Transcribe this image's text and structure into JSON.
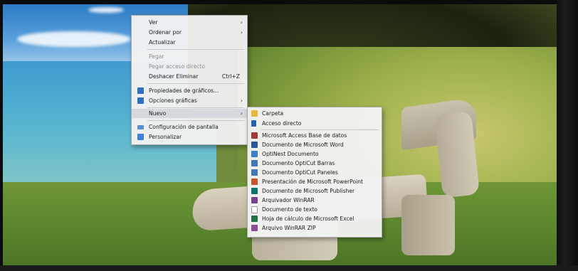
{
  "context_menu": {
    "items": [
      {
        "label": "Ver"
      },
      {
        "label": "Ordenar por"
      },
      {
        "label": "Actualizar"
      },
      {
        "label": "Pegar"
      },
      {
        "label": "Pegar acceso directo"
      },
      {
        "label": "Deshacer Eliminar",
        "shortcut": "Ctrl+Z"
      },
      {
        "label": "Propiedades de gráficos..."
      },
      {
        "label": "Opciones gráficas"
      },
      {
        "label": "Nuevo"
      },
      {
        "label": "Configuración de pantalla"
      },
      {
        "label": "Personalizar"
      }
    ]
  },
  "new_submenu": {
    "items": [
      {
        "label": "Carpeta",
        "icon": "folder-icon",
        "color": "#e8b73a"
      },
      {
        "label": "Acceso directo",
        "icon": "shortcut-icon",
        "color": "#2a62b8"
      },
      {
        "label": "Microsoft Access Base de datos",
        "icon": "access-icon",
        "color": "#a4373a"
      },
      {
        "label": "Documento de Microsoft Word",
        "icon": "word-icon",
        "color": "#2b579a"
      },
      {
        "label": "OptiNest Documento",
        "icon": "optinest-icon",
        "color": "#3a7fc9"
      },
      {
        "label": "Documento OptiCut Barras",
        "icon": "opticut-bars-icon",
        "color": "#3f78b6"
      },
      {
        "label": "Documento OptiCut Paneles",
        "icon": "opticut-panels-icon",
        "color": "#3f78b6"
      },
      {
        "label": "Presentación de Microsoft PowerPoint",
        "icon": "powerpoint-icon",
        "color": "#c8502a"
      },
      {
        "label": "Documento de Microsoft Publisher",
        "icon": "publisher-icon",
        "color": "#077568"
      },
      {
        "label": "Arquivador WinRAR",
        "icon": "winrar-icon",
        "color": "#7b3f8f"
      },
      {
        "label": "Documento de texto",
        "icon": "text-file-icon",
        "color": "#d8d8d8"
      },
      {
        "label": "Hoja de cálculo de Microsoft Excel",
        "icon": "excel-icon",
        "color": "#217346"
      },
      {
        "label": "Arquivo WinRAR ZIP",
        "icon": "zip-icon",
        "color": "#8a4b9a"
      }
    ]
  },
  "colors": {
    "menu_bg": "#f2f2f2",
    "highlight": "#d6d9de",
    "disabled_text": "#8e8e8e"
  }
}
